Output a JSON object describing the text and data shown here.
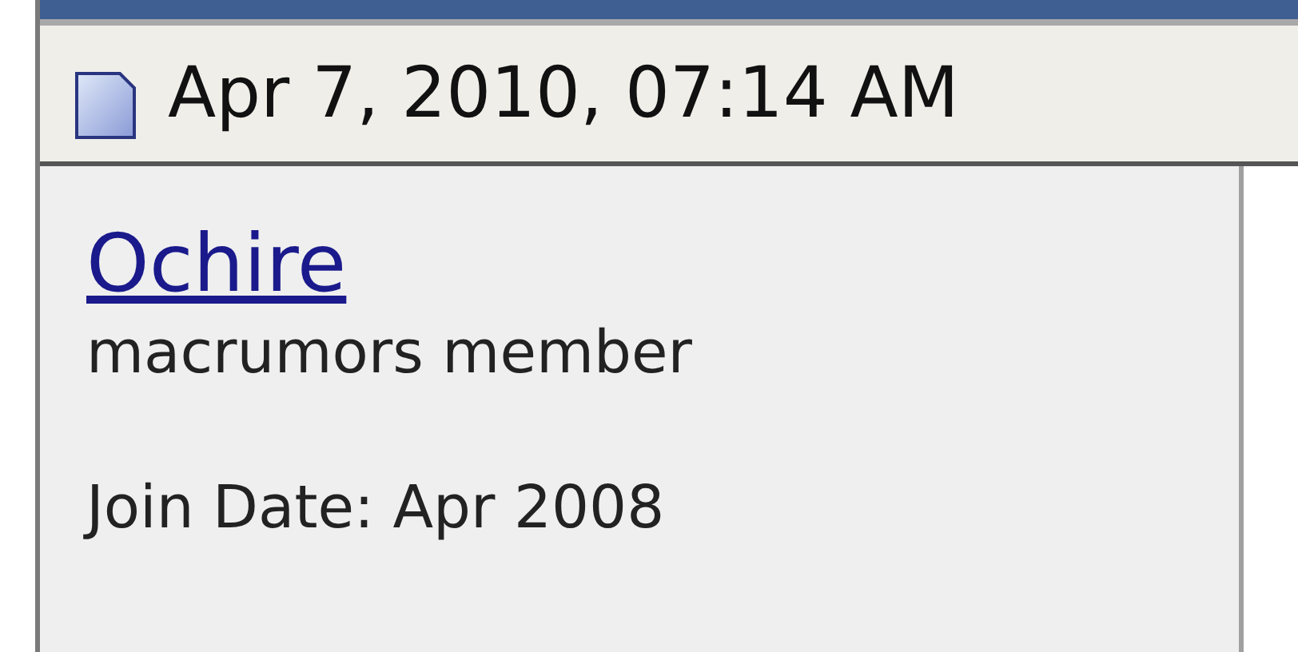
{
  "post_header": {
    "date": "Apr 7, 2010, 07:14 AM"
  },
  "user_info": {
    "username": "Ochire",
    "title": "macrumors member",
    "join_date": "Join Date: Apr 2008"
  }
}
